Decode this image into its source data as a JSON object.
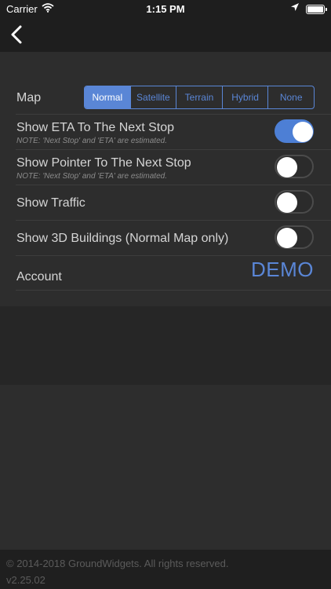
{
  "status_bar": {
    "carrier": "Carrier",
    "wifi_icon": "wifi-icon",
    "time": "1:15 PM",
    "location_icon": "location-arrow-icon",
    "battery_icon": "battery-icon"
  },
  "nav": {
    "back_icon": "chevron-left-icon"
  },
  "settings": {
    "map": {
      "label": "Map",
      "options": [
        "Normal",
        "Satellite",
        "Terrain",
        "Hybrid",
        "None"
      ],
      "selected": "Normal"
    },
    "eta": {
      "label": "Show ETA To The Next Stop",
      "note": "NOTE: 'Next Stop' and 'ETA' are estimated.",
      "enabled": true
    },
    "pointer": {
      "label": "Show Pointer To The Next Stop",
      "note": "NOTE: 'Next Stop' and 'ETA' are estimated.",
      "enabled": false
    },
    "traffic": {
      "label": "Show Traffic",
      "enabled": false
    },
    "buildings": {
      "label": "Show 3D Buildings (Normal Map only)",
      "enabled": false
    },
    "account": {
      "label": "Account",
      "value": "DEMO"
    }
  },
  "footer": {
    "copyright": "© 2014-2018 GroundWidgets.  All rights reserved.",
    "version": "v2.25.02"
  },
  "colors": {
    "accent": "#5a86d6",
    "background": "#2b2b2b"
  }
}
